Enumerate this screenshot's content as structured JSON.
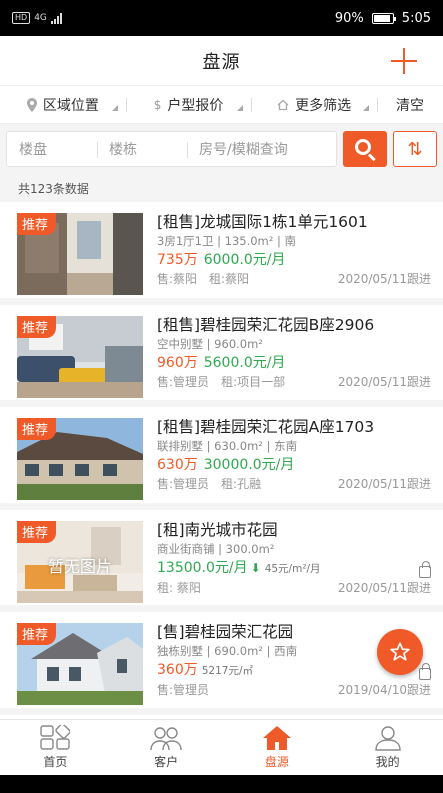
{
  "status_bar": {
    "network": "HD",
    "network_gen": "4G",
    "battery": "90%",
    "battery_level": 0.9,
    "time": "5:05"
  },
  "header": {
    "title": "盘源",
    "add_icon": "plus-icon"
  },
  "filters": [
    {
      "label": "区域位置",
      "icon": "location-pin-icon"
    },
    {
      "label": "户型报价",
      "icon": "yuan-icon"
    },
    {
      "label": "更多筛选",
      "icon": "home-icon"
    },
    {
      "label": "清空"
    }
  ],
  "search": {
    "placeholders": [
      "楼盘",
      "楼栋",
      "房号/模糊查询"
    ],
    "search_icon": "search-icon",
    "sort_icon": "sort-icon",
    "sort_glyph": "⇅"
  },
  "count_text": "共123条数据",
  "listings": [
    {
      "badge": "推荐",
      "title": "[租售]龙城国际1栋1单元1601",
      "spec": "3房1厅1卫 | 135.0m² | 南",
      "sale_price": "735万",
      "rent_price": "6000.0元/月",
      "agents": [
        "售:蔡阳",
        "租:蔡阳"
      ],
      "date": "2020/05/11跟进",
      "locked": false
    },
    {
      "badge": "推荐",
      "title": "[租售]碧桂园荣汇花园B座2906",
      "spec": "空中别墅 | 960.0m²",
      "sale_price": "960万",
      "rent_price": "5600.0元/月",
      "agents": [
        "售:管理员",
        "租:项目一部"
      ],
      "date": "2020/05/11跟进",
      "locked": false
    },
    {
      "badge": "推荐",
      "title": "[租售]碧桂园荣汇花园A座1703",
      "spec": "联排别墅 | 630.0m² | 东南",
      "sale_price": "630万",
      "rent_price": "30000.0元/月",
      "agents": [
        "售:管理员",
        "租:孔融"
      ],
      "date": "2020/05/11跟进",
      "locked": false
    },
    {
      "badge": "推荐",
      "title": "[租]南光城市花园",
      "spec": "商业街商铺 | 300.0m²",
      "rent_price": "13500.0元/月",
      "trend": "⬇",
      "unit_price": "45元/m²/月",
      "no_image_text": "暂无图片",
      "agents": [
        "租: 蔡阳"
      ],
      "date": "2020/05/11跟进",
      "locked": true
    },
    {
      "badge": "推荐",
      "title": "[售]碧桂园荣汇花园",
      "spec": "独栋别墅 | 690.0m² | 西南",
      "sale_price": "360万",
      "unit_price": "5217元/㎡",
      "agents": [
        "售:管理员"
      ],
      "date": "2019/04/10跟进",
      "locked": true
    }
  ],
  "fab_icon": "star-icon",
  "tabs": [
    {
      "label": "首页",
      "icon": "grid-icon",
      "active": false
    },
    {
      "label": "客户",
      "icon": "people-icon",
      "active": false
    },
    {
      "label": "盘源",
      "icon": "house-icon",
      "active": true
    },
    {
      "label": "我的",
      "icon": "user-icon",
      "active": false
    }
  ],
  "colors": {
    "accent": "#f05a28",
    "rent_green": "#2fa84f",
    "muted": "#999999",
    "background": "#f4f4f4"
  }
}
